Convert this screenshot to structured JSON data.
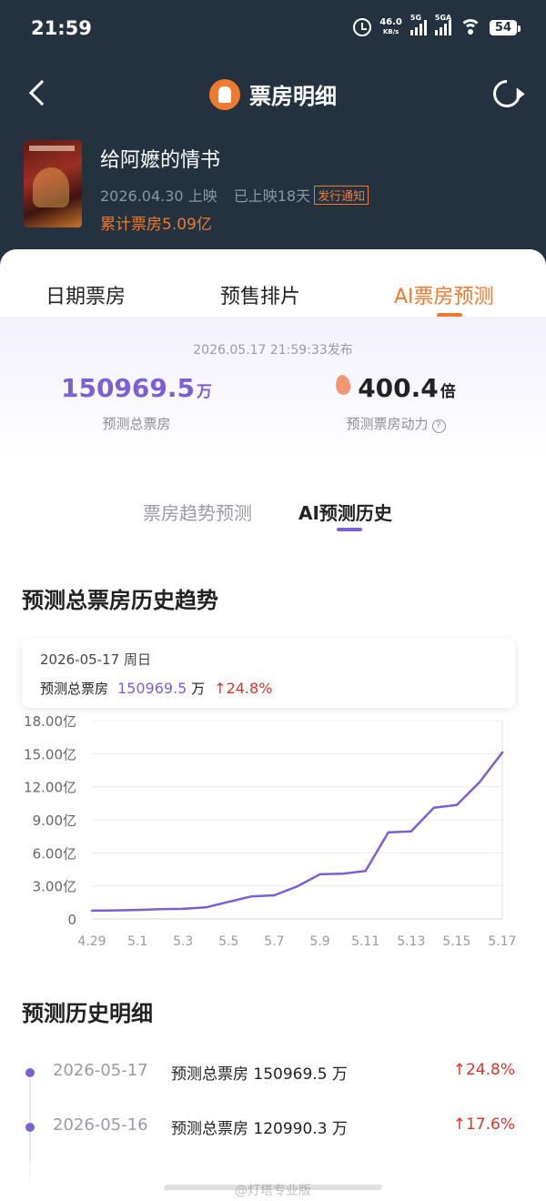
{
  "status_bar": {
    "time": "21:59",
    "net_speed": "46.0",
    "net_unit": "KB/s",
    "sig1": "5G",
    "sig2": "5GA",
    "battery": "54"
  },
  "header": {
    "title": "票房明细",
    "icons": {
      "back": "back-arrow-icon",
      "logo": "lighthouse-logo-icon",
      "refresh": "refresh-icon"
    }
  },
  "movie": {
    "name": "给阿嬷的情书",
    "release": "2026.04.30 上映",
    "days": "已上映18天",
    "notice": "发行通知",
    "total": "累计票房5.09亿"
  },
  "tabs": {
    "items": [
      "日期票房",
      "预售排片",
      "AI票房预测"
    ],
    "active": 2
  },
  "summary": {
    "published": "2026.05.17 21:59:33发布",
    "pred_total_value": "150969.5",
    "pred_total_unit": "万",
    "pred_total_label": "预测总票房",
    "momentum_value": "400.4",
    "momentum_unit": "倍",
    "momentum_label": "预测票房动力"
  },
  "subtabs": {
    "items": [
      "票房趋势预测",
      "AI预测历史"
    ],
    "active": 1
  },
  "trend_section": {
    "title": "预测总票房历史趋势"
  },
  "tooltip": {
    "date": "2026-05-17  周日",
    "label": "预测总票房",
    "value": "150969.5",
    "unit": "万",
    "change": "↑24.8%"
  },
  "chart_data": {
    "type": "line",
    "x": [
      "4.29",
      "4.30",
      "5.1",
      "5.2",
      "5.3",
      "5.4",
      "5.5",
      "5.6",
      "5.7",
      "5.8",
      "5.9",
      "5.10",
      "5.11",
      "5.12",
      "5.13",
      "5.14",
      "5.15",
      "5.16",
      "5.17"
    ],
    "x_tick_labels": [
      "4.29",
      "5.1",
      "5.3",
      "5.5",
      "5.7",
      "5.9",
      "5.11",
      "5.13",
      "5.15",
      "5.17"
    ],
    "series": [
      {
        "values": [
          0.75,
          0.78,
          0.82,
          0.88,
          0.92,
          1.05,
          1.55,
          2.05,
          2.15,
          2.95,
          4.05,
          4.1,
          4.35,
          7.85,
          7.95,
          10.1,
          10.35,
          12.4,
          15.1
        ]
      }
    ],
    "y_tick_labels": [
      "0",
      "3.00亿",
      "6.00亿",
      "9.00亿",
      "12.00亿",
      "15.00亿",
      "18.00亿"
    ],
    "ylim": [
      0,
      18
    ],
    "y_unit": "亿",
    "grid": true,
    "color": "#7b5fd3"
  },
  "history_section": {
    "title": "预测历史明细",
    "rows": [
      {
        "date": "2026-05-17",
        "text": "预测总票房 150969.5 万",
        "change": "↑24.8%"
      },
      {
        "date": "2026-05-16",
        "text": "预测总票房 120990.3 万",
        "change": "↑17.6%"
      }
    ]
  },
  "watermark": "@灯塔专业版",
  "colors": {
    "accent": "#ef7a2f",
    "purple": "#7b5fd3",
    "up": "#d9342b",
    "header_bg": "#243240"
  }
}
